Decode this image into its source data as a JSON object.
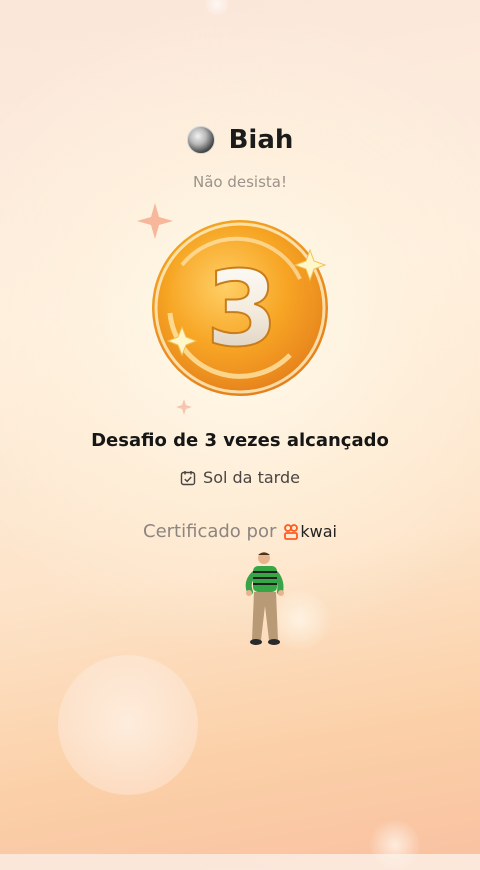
{
  "header": {
    "username": "Biah",
    "avatar": "avatar-image"
  },
  "subtitle": "Não desista!",
  "medal": {
    "number": "3"
  },
  "achievement_title": "Desafio de 3 vezes alcançado",
  "tag": {
    "icon": "calendar-check-icon",
    "label": "Sol da tarde"
  },
  "certificate": {
    "text": "Certificado por",
    "brand": "kwai",
    "brand_color": "#ff5a1f"
  },
  "colors": {
    "medal_gold": "#f3a020",
    "medal_highlight": "#ffe08a",
    "text_dark": "#161616",
    "text_muted": "#9b938c"
  }
}
